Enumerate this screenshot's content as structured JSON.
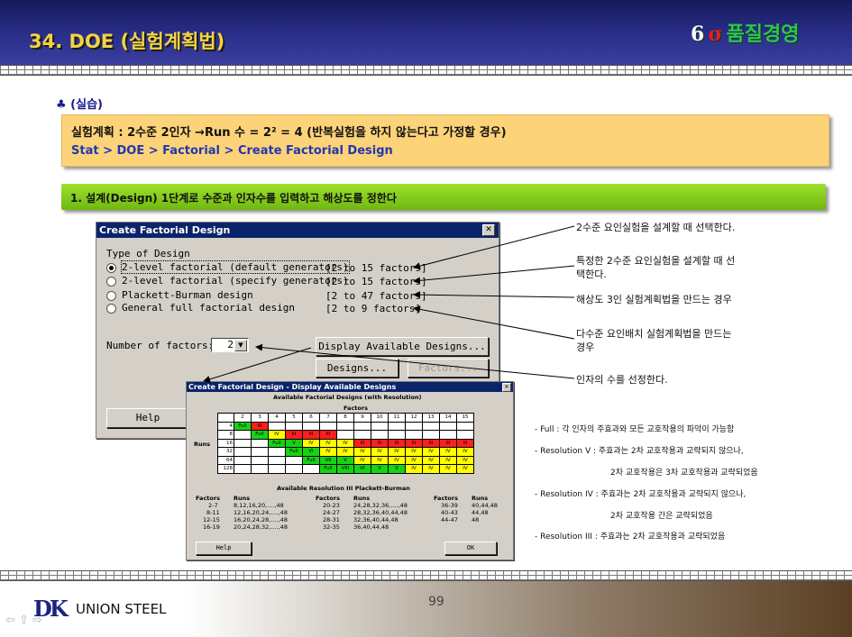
{
  "header": {
    "title": "34. DOE (실험계획법)",
    "brand_num": "6",
    "brand_sigma": "σ",
    "brand_text": "품질경영"
  },
  "practice_label": "♣ (실습)",
  "info_box": {
    "line1": "실험계획 : 2수준 2인자  →Run 수 = 2² = 4  (반복실험을 하지 않는다고 가정할 경우)",
    "line2": "Stat > DOE > Factorial > Create Factorial Design"
  },
  "step_bar": "1. 설계(Design) 1단계로 수준과 인자수를 입력하고 해상도를 정한다",
  "dialog_create": {
    "title": "Create Factorial Design",
    "close": "✕",
    "section": "Type of Design",
    "options": [
      {
        "label": "2-level factorial (default generators)",
        "range": "[2 to 15 factors]"
      },
      {
        "label": "2-level factorial (specify generators)",
        "range": "[2 to 15 factors]"
      },
      {
        "label": "Plackett-Burman design",
        "range": "[2 to 47 factors]"
      },
      {
        "label": "General full factorial design",
        "range": "[2 to 9 factors]"
      }
    ],
    "num_factors_label": "Number of factors:",
    "num_factors_value": "2",
    "display_button": "Display Available Designs...",
    "designs_button": "Designs...",
    "factors_button": "Factors...",
    "help_button": "Help"
  },
  "dialog_display": {
    "title": "Create Factorial Design - Display Available Designs",
    "subtitle": "Available Factorial Designs (with Resolution)",
    "factors_label": "Factors",
    "runs_label": "Runs",
    "factor_headers": [
      "2",
      "3",
      "4",
      "5",
      "6",
      "7",
      "8",
      "9",
      "10",
      "11",
      "12",
      "13",
      "14",
      "15"
    ],
    "rows": [
      {
        "runs": "4",
        "cells": [
          "Full",
          "III",
          "",
          "",
          "",
          "",
          "",
          "",
          "",
          "",
          "",
          "",
          "",
          ""
        ]
      },
      {
        "runs": "8",
        "cells": [
          "",
          "Full",
          "IV",
          "III",
          "III",
          "III",
          "",
          "",
          "",
          "",
          "",
          "",
          "",
          ""
        ]
      },
      {
        "runs": "16",
        "cells": [
          "",
          "",
          "Full",
          "V",
          "IV",
          "IV",
          "IV",
          "III",
          "III",
          "III",
          "III",
          "III",
          "III",
          "III"
        ]
      },
      {
        "runs": "32",
        "cells": [
          "",
          "",
          "",
          "Full",
          "VI",
          "IV",
          "IV",
          "IV",
          "IV",
          "IV",
          "IV",
          "IV",
          "IV",
          "IV"
        ]
      },
      {
        "runs": "64",
        "cells": [
          "",
          "",
          "",
          "",
          "Full",
          "VII",
          "V",
          "IV",
          "IV",
          "IV",
          "IV",
          "IV",
          "IV",
          "IV"
        ]
      },
      {
        "runs": "128",
        "cells": [
          "",
          "",
          "",
          "",
          "",
          "Full",
          "VIII",
          "VI",
          "V",
          "V",
          "IV",
          "IV",
          "IV",
          "IV"
        ]
      }
    ],
    "cell_colors": {
      "Full": "#16d316",
      "III": "#ff1e1e",
      "IV": "#ffff00",
      "V": "#16d316",
      "VI": "#16d316",
      "VII": "#16d316",
      "VIII": "#16d316"
    },
    "pb_title": "Available Resolution III Plackett-Burman",
    "pb_columns": [
      {
        "factors_header": "Factors",
        "runs_header": "Runs",
        "factors": [
          "2-7",
          "8-11",
          "12-15",
          "16-19"
        ],
        "runs": [
          "8,12,16,20,....,48",
          "12,16,20,24,....,48",
          "16,20,24,28,....,48",
          "20,24,28,32,....,48"
        ]
      },
      {
        "factors_header": "Factors",
        "runs_header": "Runs",
        "factors": [
          "20-23",
          "24-27",
          "28-31",
          "32-35"
        ],
        "runs": [
          "24,28,32,36,....,48",
          "28,32,36,40,44,48",
          "32,36,40,44,48",
          "36,40,44,48"
        ]
      },
      {
        "factors_header": "Factors",
        "runs_header": "Runs",
        "factors": [
          "36-39",
          "40-43",
          "44-47"
        ],
        "runs": [
          "40,44,48",
          "44,48",
          "48"
        ]
      }
    ],
    "help_button": "Help",
    "ok_button": "OK"
  },
  "annotations": [
    "2수준 요인실험을 설계할 때 선택한다.",
    "특정한 2수준 요인실험을 설계할 때 선",
    "택한다.",
    "해상도 3인 실험계획법을 만드는 경우",
    "다수준 요인배치 실험계획법을 만드는",
    "경우",
    "인자의 수를 선정한다."
  ],
  "resolution_notes": [
    "- Full : 각 인자의 주효과와 모든 교호작용의 파악이 가능함",
    "- Resolution V : 주효과는 2차 교호작용과 교략되지 않으나,",
    "2차 교호작용은 3차 교호작용과 교략되었음",
    "- Resolution IV : 주효과는 2차 교호작용과 교략되지 않으나,",
    "2차 교호작용 간은 교략되었음",
    "- Resolution III : 주효과는 2차 교호작용과 교략되었음"
  ],
  "footer": {
    "logo_mark": "DK",
    "logo_text": "UNION STEEL",
    "page_number": "99",
    "prev_arrow": "⇦",
    "mid_arrows": "⇦  ⇧  ⇨",
    "next_arrow": "⇨"
  }
}
